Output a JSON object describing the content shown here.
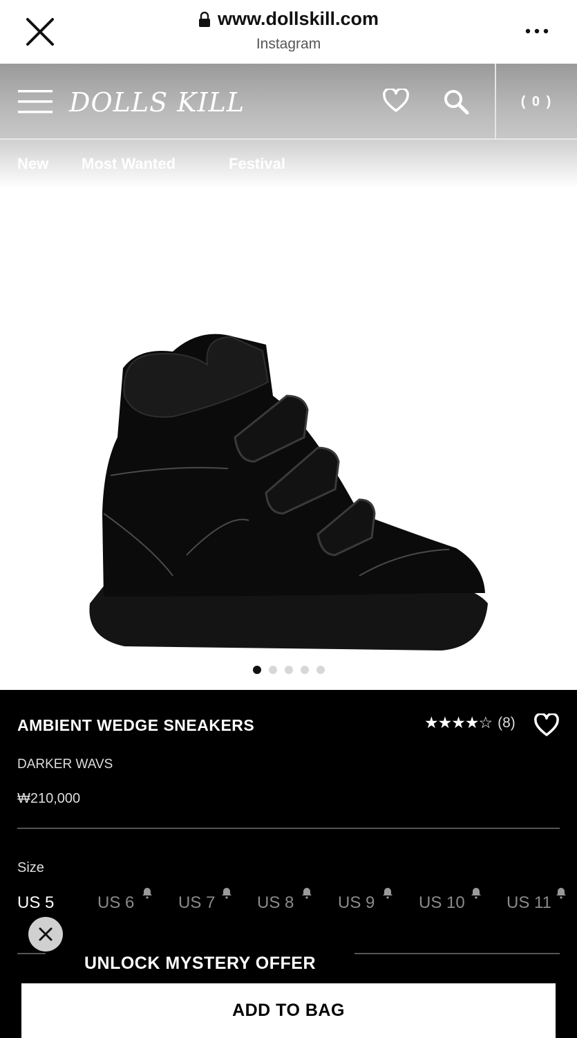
{
  "browser": {
    "url": "www.dollskill.com",
    "subtitle": "Instagram"
  },
  "site": {
    "logo": "DOLLS KILL",
    "cart_label": "( 0 )"
  },
  "nav": {
    "items": [
      "New",
      "Most Wanted",
      "Festival"
    ]
  },
  "gallery": {
    "total": 5,
    "active_index": 0
  },
  "product": {
    "title": "AMBIENT WEDGE SNEAKERS",
    "brand": "DARKER WAVS",
    "price": "₩210,000",
    "rating_stars": 4.5,
    "rating_count": "(8)",
    "size_label": "Size",
    "sizes": [
      {
        "label": "US 5",
        "available": true
      },
      {
        "label": "US 6",
        "available": false
      },
      {
        "label": "US 7",
        "available": false
      },
      {
        "label": "US 8",
        "available": false
      },
      {
        "label": "US 9",
        "available": false
      },
      {
        "label": "US 10",
        "available": false
      },
      {
        "label": "US 11",
        "available": false
      }
    ]
  },
  "offer": {
    "label": "UNLOCK MYSTERY OFFER"
  },
  "cta": {
    "add_to_bag": "ADD TO BAG"
  }
}
